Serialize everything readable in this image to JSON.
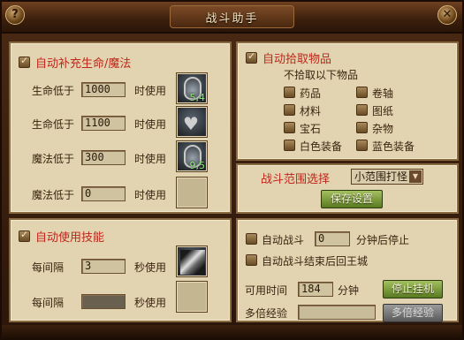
{
  "window": {
    "title": "战斗助手"
  },
  "auto_restore": {
    "title": "自动补充生命/魔法",
    "rows": [
      {
        "label": "生命低于",
        "value": "1000",
        "suffix": "时使用",
        "slot_count": "5,4"
      },
      {
        "label": "生命低于",
        "value": "1100",
        "suffix": "时使用",
        "slot_count": ""
      },
      {
        "label": "魔法低于",
        "value": "300",
        "suffix": "时使用",
        "slot_count": "9,5"
      },
      {
        "label": "魔法低于",
        "value": "0",
        "suffix": "时使用",
        "slot_count": ""
      }
    ]
  },
  "auto_pickup": {
    "title": "自动拾取物品",
    "subtitle": "不拾取以下物品",
    "items": [
      "药品",
      "卷轴",
      "材料",
      "图纸",
      "宝石",
      "杂物",
      "白色装备",
      "蓝色装备"
    ]
  },
  "range": {
    "label": "战斗范围选择",
    "selected": "小范围打怪",
    "save_label": "保存设置"
  },
  "auto_skill": {
    "title": "自动使用技能",
    "rows": [
      {
        "label": "每间隔",
        "value": "3",
        "suffix": "秒使用"
      },
      {
        "label": "每间隔",
        "value": "",
        "suffix": "秒使用"
      }
    ]
  },
  "auto_battle": {
    "auto_fight_label": "自动战斗",
    "auto_fight_value": "0",
    "auto_fight_suffix": "分钟后停止",
    "return_label": "自动战斗结束后回王城",
    "available_label": "可用时间",
    "available_value": "184",
    "available_unit": "分钟",
    "multi_exp_label": "多倍经验",
    "stop_label": "停止挂机",
    "multi_exp_button": "多倍经验"
  }
}
